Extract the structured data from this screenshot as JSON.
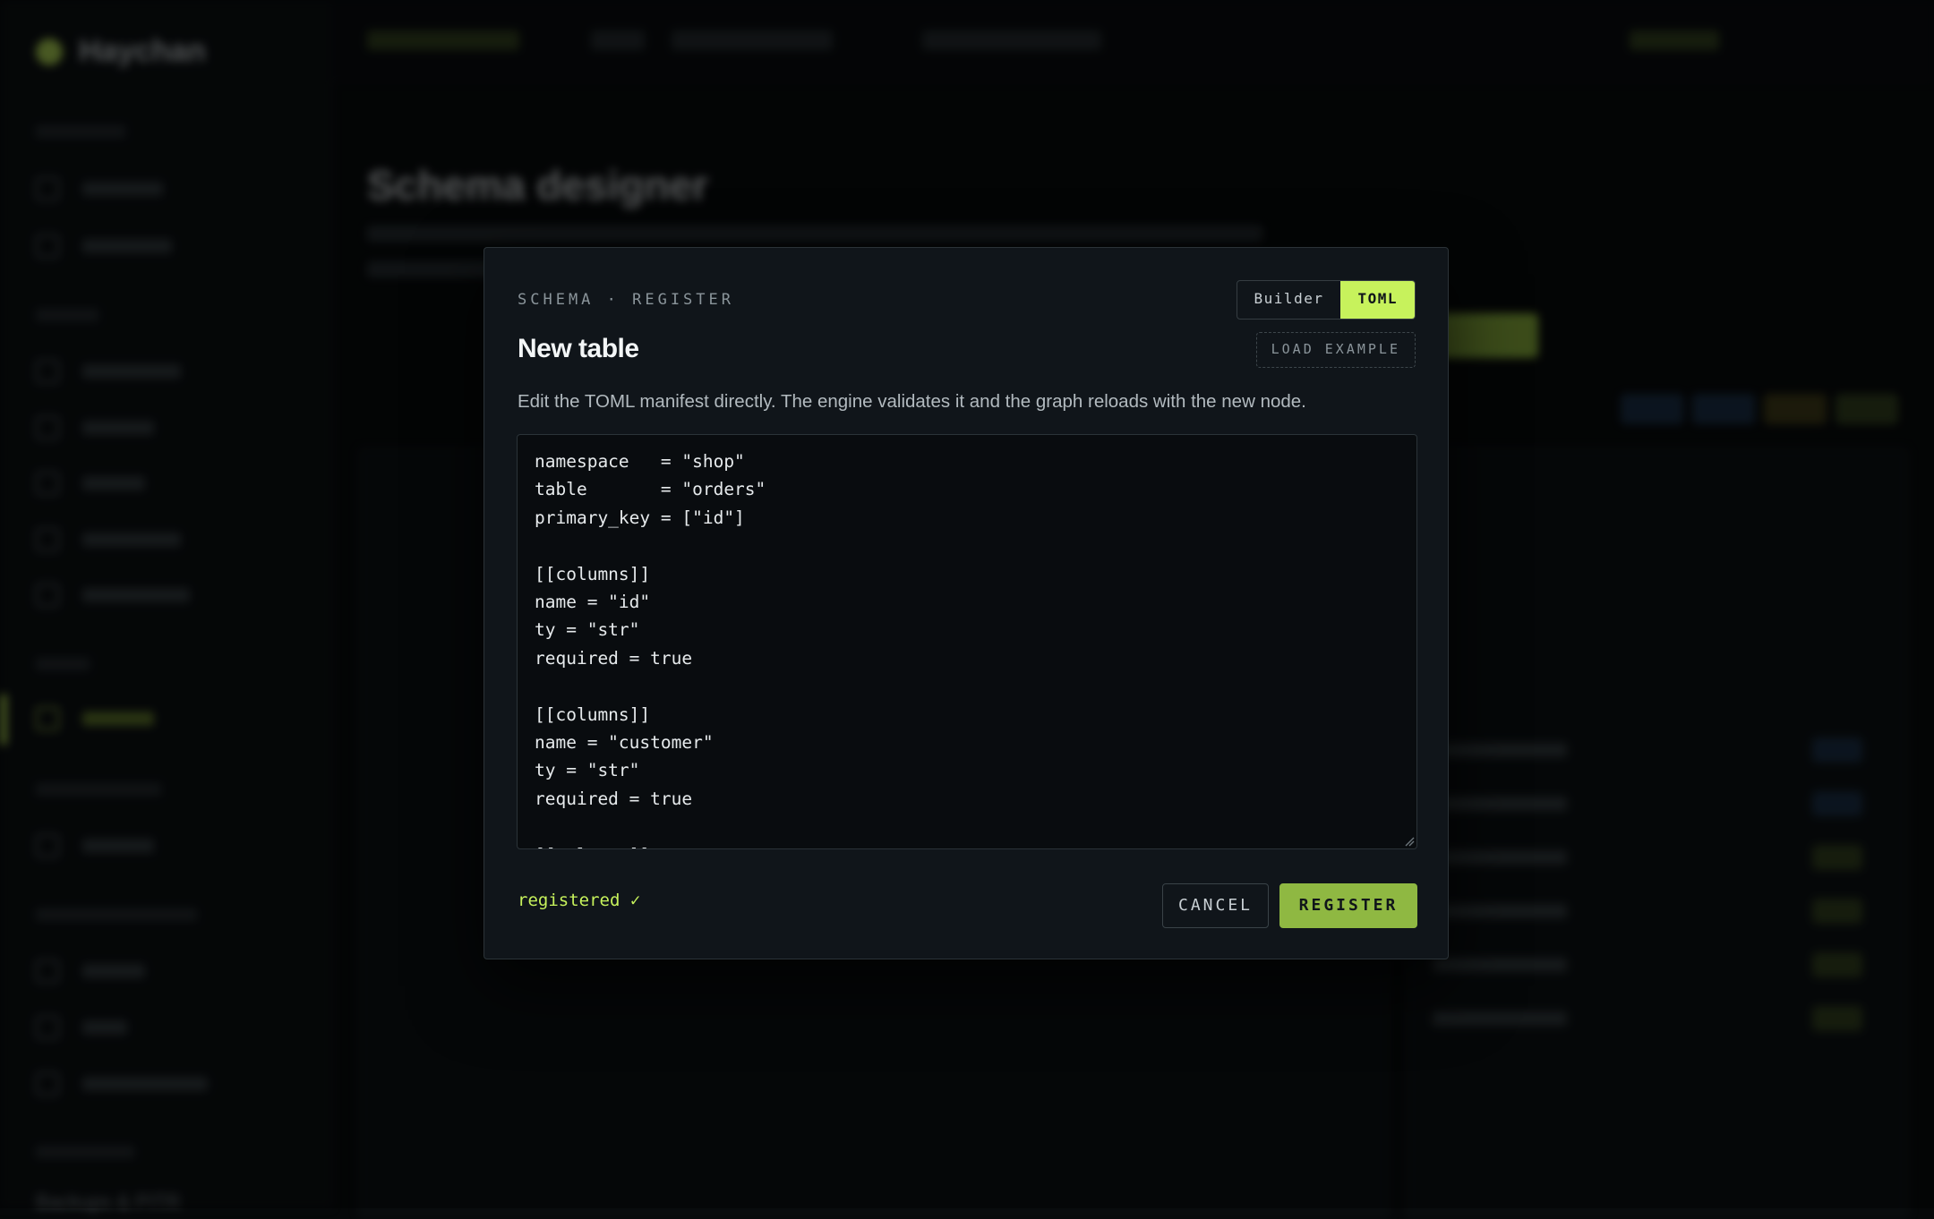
{
  "background": {
    "app_name": "Haychan",
    "page_title": "Schema designer",
    "bottom_nav_label": "Backups & PITR"
  },
  "modal": {
    "eyebrow": "SCHEMA · REGISTER",
    "title": "New table",
    "mode_toggle": {
      "options": [
        "Builder",
        "TOML"
      ],
      "selected": "TOML"
    },
    "load_example_label": "LOAD EXAMPLE",
    "description": "Edit the TOML manifest directly. The engine validates it and the graph reloads with the new node.",
    "editor_value": "namespace   = \"shop\"\ntable       = \"orders\"\nprimary_key = [\"id\"]\n\n[[columns]]\nname = \"id\"\nty = \"str\"\nrequired = true\n\n[[columns]]\nname = \"customer\"\nty = \"str\"\nrequired = true\n\n[[columns]]",
    "status": "registered ✓",
    "cancel_label": "CANCEL",
    "register_label": "REGISTER"
  },
  "colors": {
    "accent": "#c7f25c",
    "register_button": "#8fb842",
    "modal_bg": "#10151a",
    "editor_bg": "#090c0f"
  }
}
